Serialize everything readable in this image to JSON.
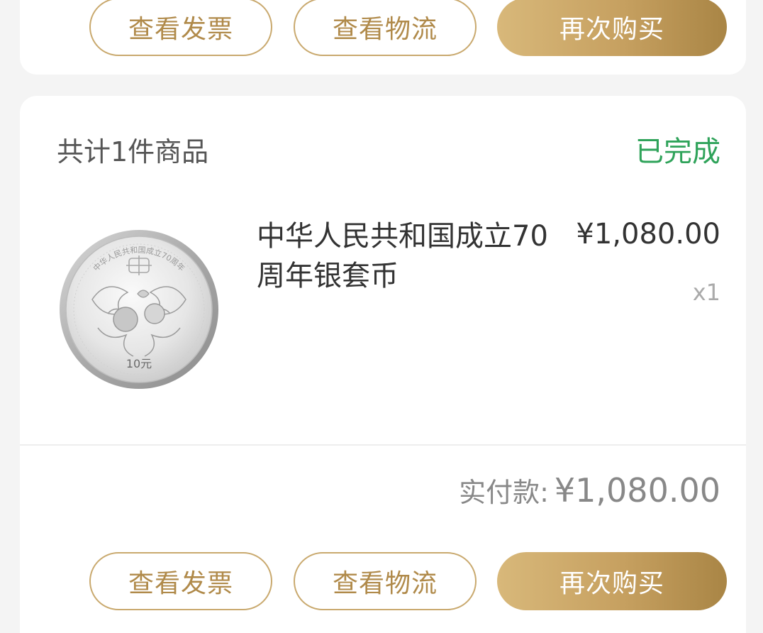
{
  "top_card": {
    "buttons": {
      "invoice": "查看发票",
      "logistics": "查看物流",
      "rebuy": "再次购买"
    }
  },
  "order": {
    "count_label": "共计1件商品",
    "status": "已完成",
    "status_color": "#2fa35a",
    "product": {
      "title": "中华人民共和国成立70周年银套币",
      "price": "¥1,080.00",
      "quantity": "x1",
      "image": {
        "inscription": "中华人民共和国成立70周年",
        "denomination": "10元",
        "icon": "silver-coin-icon"
      }
    },
    "paid_label": "实付款:",
    "paid_amount": "¥1,080.00",
    "buttons": {
      "invoice": "查看发票",
      "logistics": "查看物流",
      "rebuy": "再次购买"
    }
  },
  "colors": {
    "accent_gold": "#c6a060",
    "outline_gold": "#c9a96e",
    "background": "#f4f4f4"
  }
}
